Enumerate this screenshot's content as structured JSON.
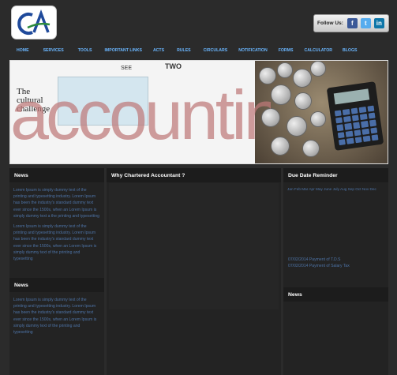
{
  "logo": {
    "text": "CA",
    "colors": {
      "c": "#1f4a9b",
      "a": "#2a8a3c"
    }
  },
  "follow": {
    "label": "Follow Us:",
    "icons": [
      "facebook-icon",
      "twitter-icon",
      "linkedin-icon"
    ],
    "fb_glyph": "f",
    "tw_glyph": "t",
    "li_glyph": "in"
  },
  "nav": {
    "items": [
      "HOME",
      "SERVICES",
      "TOOLS",
      "IMPORTANT LINKS",
      "ACTS",
      "RULES",
      "CIRCULARS",
      "NOTIFICATION",
      "FORMS",
      "CALCULATOR",
      "BLOGS"
    ],
    "color": "#6ab6ff"
  },
  "banner": {
    "big_word": "accounting",
    "cultural_line1": "The",
    "cultural_line2": "cultural",
    "cultural_line3": "challenge",
    "small_words": [
      "TWO",
      "SEE"
    ]
  },
  "news_left": {
    "title": "News",
    "paragraphs": [
      "Lorem Ipsum is simply dummy text of the printing and typesetting industry. Lorem Ipsum has been the industry's standard dummy text ever since the 1500s, when an Lorem Ipsum is simply dummy text a the printing and typesetting",
      "Lorem Ipsum is simply dummy text of the printing and typesetting industry. Lorem Ipsum has been the industry's standard dummy text ever since the 1500s, when an Lorem Ipsum is simply dummy text of the printing and typesetting"
    ]
  },
  "news_left2": {
    "title": "News",
    "paragraphs": [
      "Lorem Ipsum is simply dummy text of the printing and typesetting industry. Lorem Ipsum has been the industry's standard dummy text ever since the 1500s, when an Lorem Ipsum is simply dummy text of the printing and typesetting"
    ]
  },
  "middle": {
    "title": "Why Chartered Accountant ?"
  },
  "due_date": {
    "title": "Due Date Reminder",
    "calendar_strip": "Jan Feb Mar Apr May June July Aug Sep Oct Nov Dec",
    "entries": [
      "07/02/2014 Payment of T.D.S",
      "07/02/2014 Payment of Salary Tax"
    ]
  },
  "news_right": {
    "title": "News"
  },
  "accent_colors": {
    "text_blue": "#4d73a6",
    "header_bg": "#1c1c1c",
    "page_bg": "#2b2b2b"
  }
}
